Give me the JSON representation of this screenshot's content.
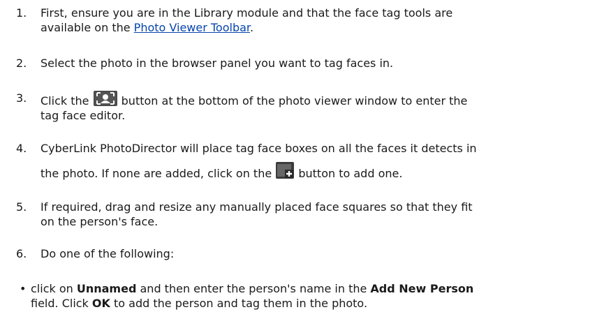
{
  "steps": [
    {
      "num": "1.",
      "line1": "First, ensure you are in the Library module and that the face tag tools are",
      "line2_pre": "available on the ",
      "link": "Photo Viewer Toolbar",
      "line2_post": "."
    },
    {
      "num": "2.",
      "line1": "Select the photo in the browser panel you want to tag faces in."
    },
    {
      "num": "3.",
      "line1_pre": "Click the ",
      "line1_post": " button at the bottom of the photo viewer window to enter the",
      "line2": "tag face editor."
    },
    {
      "num": "4.",
      "line1": "CyberLink PhotoDirector will place tag face boxes on all the faces it detects in",
      "line2_pre": "the photo. If none are added, click on the ",
      "line2_post": " button to add one."
    },
    {
      "num": "5.",
      "line1": "If required, drag and resize any manually placed face squares so that they fit",
      "line2": "on the person's face."
    },
    {
      "num": "6.",
      "line1": "Do one of the following:"
    }
  ],
  "bullet": {
    "dot": "•",
    "l1_a": "click on ",
    "l1_b": "Unnamed",
    "l1_c": " and then enter the person's name in the ",
    "l1_d": "Add New Person",
    "l2_a": "field. Click ",
    "l2_b": "OK",
    "l2_c": " to add the person and tag them in the photo."
  },
  "icons": {
    "tag_face": "tag-face-icon",
    "add_face": "add-face-icon"
  }
}
